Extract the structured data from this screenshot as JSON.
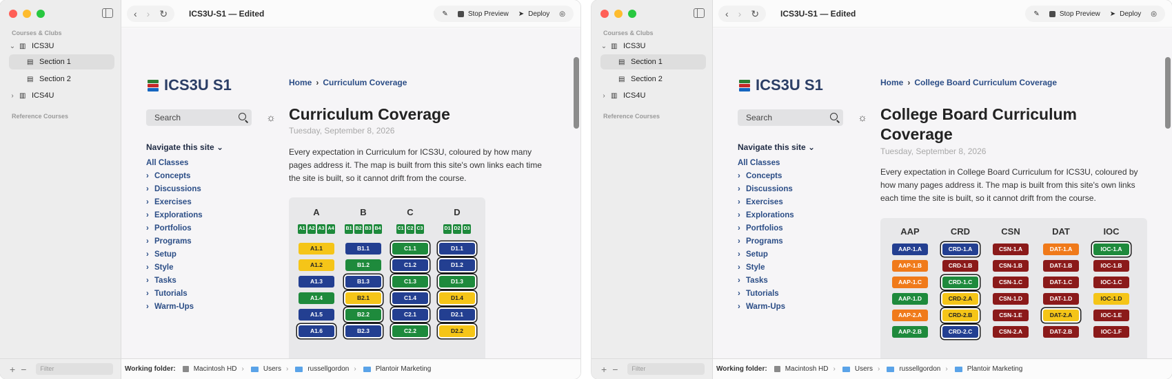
{
  "windows": [
    {
      "title": "ICS3U-S1 — Edited",
      "sidebar": {
        "section_courses": "Courses & Clubs",
        "items": [
          {
            "label": "ICS3U",
            "chevron": "⌄"
          },
          {
            "label": "Section 1"
          },
          {
            "label": "Section 2"
          },
          {
            "label": "ICS4U",
            "chevron": "›"
          }
        ],
        "section_reference": "Reference Courses",
        "filter_placeholder": "Filter",
        "add": "+",
        "remove": "−"
      },
      "toolbar": {
        "stop_preview": "Stop Preview",
        "deploy": "Deploy"
      },
      "site": {
        "title": "ICS3U S1",
        "search_placeholder": "Search",
        "nav_heading": "Navigate this site",
        "nav_items": [
          "All Classes",
          "Concepts",
          "Discussions",
          "Exercises",
          "Explorations",
          "Portfolios",
          "Programs",
          "Setup",
          "Style",
          "Tasks",
          "Tutorials",
          "Warm-Ups"
        ]
      },
      "article": {
        "crumb_home": "Home",
        "crumb_current": "Curriculum Coverage",
        "title_lines": [
          "Curriculum Coverage"
        ],
        "date": "Tuesday, September 8, 2026",
        "para_lines": [
          "Every expectation in Curriculum for ICS3U, coloured by how many",
          "pages address it. The map is built from this site's own links each time",
          "the site is built, so it cannot drift from the course."
        ]
      },
      "coverage": {
        "columns": [
          {
            "head": "A",
            "minis": [
              "A1",
              "A2",
              "A3",
              "A4"
            ],
            "mini_color": "#1e8a3c",
            "pills": [
              {
                "label": "A1.1",
                "color": "#f5c518",
                "ring": false
              },
              {
                "label": "A1.2",
                "color": "#f5c518",
                "ring": false
              },
              {
                "label": "A1.3",
                "color": "#233f91",
                "ring": false
              },
              {
                "label": "A1.4",
                "color": "#1e8a3c",
                "ring": false
              },
              {
                "label": "A1.5",
                "color": "#233f91",
                "ring": false
              },
              {
                "label": "A1.6",
                "color": "#233f91",
                "ring": true
              }
            ]
          },
          {
            "head": "B",
            "minis": [
              "B1",
              "B2",
              "B3",
              "B4"
            ],
            "mini_color": "#1e8a3c",
            "pills": [
              {
                "label": "B1.1",
                "color": "#233f91",
                "ring": false
              },
              {
                "label": "B1.2",
                "color": "#1e8a3c",
                "ring": false
              },
              {
                "label": "B1.3",
                "color": "#233f91",
                "ring": true
              },
              {
                "label": "B2.1",
                "color": "#f5c518",
                "ring": true
              },
              {
                "label": "B2.2",
                "color": "#1e8a3c",
                "ring": true
              },
              {
                "label": "B2.3",
                "color": "#233f91",
                "ring": true
              }
            ]
          },
          {
            "head": "C",
            "minis": [
              "C1",
              "C2",
              "C3"
            ],
            "mini_color": "#1e8a3c",
            "pills": [
              {
                "label": "C1.1",
                "color": "#1e8a3c",
                "ring": true
              },
              {
                "label": "C1.2",
                "color": "#233f91",
                "ring": true
              },
              {
                "label": "C1.3",
                "color": "#1e8a3c",
                "ring": true
              },
              {
                "label": "C1.4",
                "color": "#233f91",
                "ring": true
              },
              {
                "label": "C2.1",
                "color": "#233f91",
                "ring": true
              },
              {
                "label": "C2.2",
                "color": "#1e8a3c",
                "ring": true
              }
            ]
          },
          {
            "head": "D",
            "minis": [
              "D1",
              "D2",
              "D3"
            ],
            "mini_color": "#1e8a3c",
            "pills": [
              {
                "label": "D1.1",
                "color": "#233f91",
                "ring": true
              },
              {
                "label": "D1.2",
                "color": "#233f91",
                "ring": true
              },
              {
                "label": "D1.3",
                "color": "#1e8a3c",
                "ring": true
              },
              {
                "label": "D1.4",
                "color": "#f5c518",
                "ring": true
              },
              {
                "label": "D2.1",
                "color": "#233f91",
                "ring": true
              },
              {
                "label": "D2.2",
                "color": "#f5c518",
                "ring": true
              }
            ]
          }
        ]
      },
      "status": {
        "working_folder": "Working folder:",
        "path": [
          "Macintosh HD",
          "Users",
          "russellgordon",
          "Plantoir Marketing"
        ]
      }
    },
    {
      "title": "ICS3U-S1 — Edited",
      "sidebar": {
        "section_courses": "Courses & Clubs",
        "items": [
          {
            "label": "ICS3U",
            "chevron": "⌄"
          },
          {
            "label": "Section 1"
          },
          {
            "label": "Section 2"
          },
          {
            "label": "ICS4U",
            "chevron": "›"
          }
        ],
        "section_reference": "Reference Courses",
        "filter_placeholder": "Filter",
        "add": "+",
        "remove": "−"
      },
      "toolbar": {
        "stop_preview": "Stop Preview",
        "deploy": "Deploy"
      },
      "site": {
        "title": "ICS3U S1",
        "search_placeholder": "Search",
        "nav_heading": "Navigate this site",
        "nav_items": [
          "All Classes",
          "Concepts",
          "Discussions",
          "Exercises",
          "Explorations",
          "Portfolios",
          "Programs",
          "Setup",
          "Style",
          "Tasks",
          "Tutorials",
          "Warm-Ups"
        ]
      },
      "article": {
        "crumb_home": "Home",
        "crumb_current": "College Board Curriculum Coverage",
        "title_lines": [
          "College Board Curriculum",
          "Coverage"
        ],
        "date": "Tuesday, September 8, 2026",
        "para_lines": [
          "Every expectation in College Board Curriculum for ICS3U, coloured by",
          "how many pages address it. The map is built from this site's own links",
          "each time the site is built, so it cannot drift from the course."
        ]
      },
      "coverage": {
        "columns": [
          {
            "head": "AAP",
            "minis": [],
            "pills": [
              {
                "label": "AAP-1.A",
                "color": "#233f91",
                "ring": false
              },
              {
                "label": "AAP-1.B",
                "color": "#f07a1a",
                "ring": false
              },
              {
                "label": "AAP-1.C",
                "color": "#f07a1a",
                "ring": false
              },
              {
                "label": "AAP-1.D",
                "color": "#1e8a3c",
                "ring": false
              },
              {
                "label": "AAP-2.A",
                "color": "#f07a1a",
                "ring": false
              },
              {
                "label": "AAP-2.B",
                "color": "#1e8a3c",
                "ring": false
              }
            ]
          },
          {
            "head": "CRD",
            "minis": [],
            "pills": [
              {
                "label": "CRD-1.A",
                "color": "#233f91",
                "ring": true
              },
              {
                "label": "CRD-1.B",
                "color": "#8b1a1a",
                "ring": false
              },
              {
                "label": "CRD-1.C",
                "color": "#1e8a3c",
                "ring": true
              },
              {
                "label": "CRD-2.A",
                "color": "#f5c518",
                "ring": true
              },
              {
                "label": "CRD-2.B",
                "color": "#f5c518",
                "ring": true
              },
              {
                "label": "CRD-2.C",
                "color": "#233f91",
                "ring": true
              }
            ]
          },
          {
            "head": "CSN",
            "minis": [],
            "pills": [
              {
                "label": "CSN-1.A",
                "color": "#8b1a1a",
                "ring": false
              },
              {
                "label": "CSN-1.B",
                "color": "#8b1a1a",
                "ring": false
              },
              {
                "label": "CSN-1.C",
                "color": "#8b1a1a",
                "ring": false
              },
              {
                "label": "CSN-1.D",
                "color": "#8b1a1a",
                "ring": false
              },
              {
                "label": "CSN-1.E",
                "color": "#8b1a1a",
                "ring": false
              },
              {
                "label": "CSN-2.A",
                "color": "#8b1a1a",
                "ring": false
              }
            ]
          },
          {
            "head": "DAT",
            "minis": [],
            "pills": [
              {
                "label": "DAT-1.A",
                "color": "#f07a1a",
                "ring": false
              },
              {
                "label": "DAT-1.B",
                "color": "#8b1a1a",
                "ring": false
              },
              {
                "label": "DAT-1.C",
                "color": "#8b1a1a",
                "ring": false
              },
              {
                "label": "DAT-1.D",
                "color": "#8b1a1a",
                "ring": false
              },
              {
                "label": "DAT-2.A",
                "color": "#f5c518",
                "ring": true
              },
              {
                "label": "DAT-2.B",
                "color": "#8b1a1a",
                "ring": false
              }
            ]
          },
          {
            "head": "IOC",
            "minis": [],
            "pills": [
              {
                "label": "IOC-1.A",
                "color": "#1e8a3c",
                "ring": true
              },
              {
                "label": "IOC-1.B",
                "color": "#8b1a1a",
                "ring": false
              },
              {
                "label": "IOC-1.C",
                "color": "#8b1a1a",
                "ring": false
              },
              {
                "label": "IOC-1.D",
                "color": "#f5c518",
                "ring": false
              },
              {
                "label": "IOC-1.E",
                "color": "#8b1a1a",
                "ring": false
              },
              {
                "label": "IOC-1.F",
                "color": "#8b1a1a",
                "ring": false
              }
            ]
          }
        ]
      },
      "status": {
        "working_folder": "Working folder:",
        "path": [
          "Macintosh HD",
          "Users",
          "russellgordon",
          "Plantoir Marketing"
        ]
      }
    }
  ]
}
